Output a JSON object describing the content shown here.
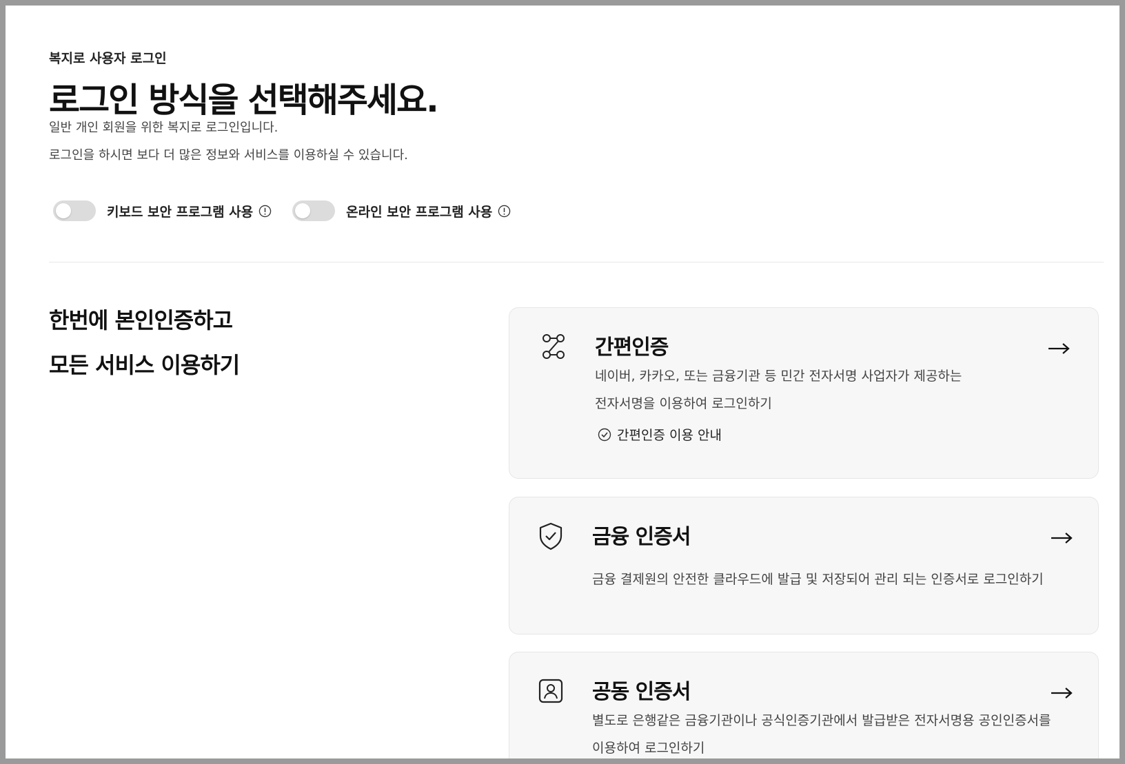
{
  "header": {
    "eyebrow": "복지로 사용자 로그인",
    "title": "로그인 방식을 선택해주세요.",
    "desc_line1": "일반 개인 회원을 위한 복지로 로그인입니다.",
    "desc_line2": "로그인을 하시면 보다 더 많은 정보와 서비스를 이용하실 수 있습니다."
  },
  "toggles": [
    {
      "label": "키보드 보안 프로그램 사용",
      "on": false
    },
    {
      "label": "온라인 보안 프로그램 사용",
      "on": false
    }
  ],
  "section": {
    "line1": "한번에 본인인증하고",
    "line2": "모든 서비스 이용하기"
  },
  "cards": [
    {
      "title": "간편인증",
      "desc_line1": "네이버, 카카오, 또는 금융기관 등 민간 전자서명 사업자가 제공하는",
      "desc_line2": "전자서명을 이용하여 로그인하기",
      "guide": "간편인증 이용 안내",
      "icon": "route-icon"
    },
    {
      "title": "금융 인증서",
      "desc_line1": "금융 결제원의 안전한 클라우드에 발급 및 저장되어 관리 되는 인증서로 로그인하기",
      "icon": "shield-check-icon"
    },
    {
      "title": "공동 인증서",
      "desc_line1": "별도로 은행같은 금융기관이나 공식인증기관에서 발급받은 전자서명용 공인인증서를",
      "desc_line2": "이용하여 로그인하기",
      "icon": "id-card-icon"
    }
  ]
}
